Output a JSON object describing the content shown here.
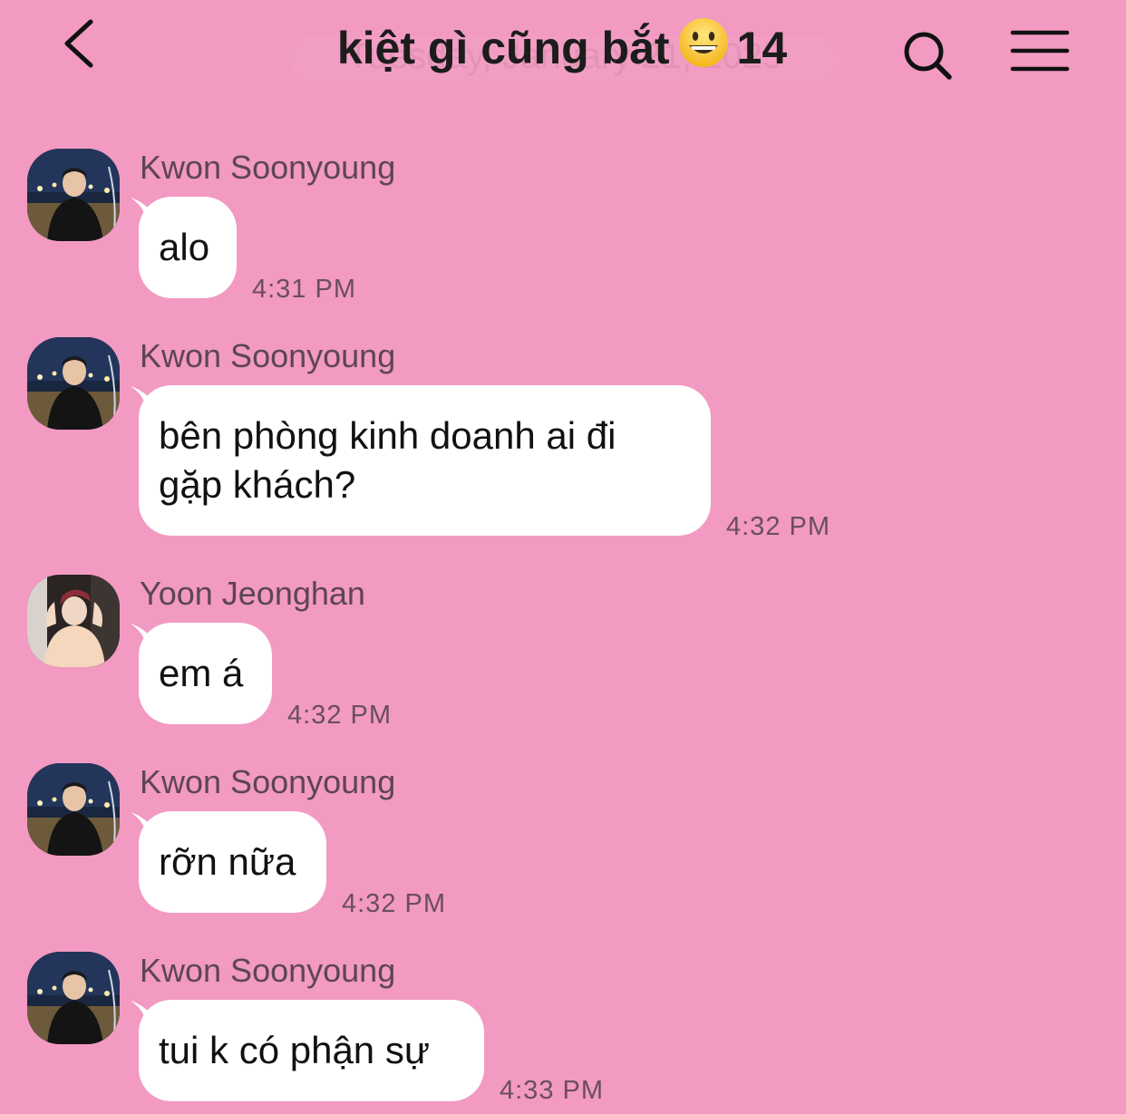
{
  "header": {
    "title": "kiệt gì cũng bắt",
    "member_count": "14",
    "date_ghost": "Tuesday, January 21, 2025",
    "icons": {
      "back": "chevron-left-icon",
      "search": "search-icon",
      "menu": "hamburger-menu-icon",
      "title_emoji": "grinning-face-emoji"
    }
  },
  "messages": [
    {
      "sender": "Kwon Soonyoung",
      "text": "alo",
      "time": "4:31 PM"
    },
    {
      "sender": "Kwon Soonyoung",
      "text_line1": "bên phòng kinh doanh ai đi",
      "text_line2": "gặp khách?",
      "time": "4:32 PM"
    },
    {
      "sender": "Yoon Jeonghan",
      "text": "em á",
      "time": "4:32 PM"
    },
    {
      "sender": "Kwon Soonyoung",
      "text": "rỡn nữa",
      "time": "4:32 PM"
    },
    {
      "sender": "Kwon Soonyoung",
      "text": "tui k có phận sự",
      "time": "4:33 PM"
    }
  ],
  "colors": {
    "background": "#f29ac2",
    "bubble": "#ffffff",
    "sender_text": "#5d4555",
    "time_text": "#6a4e5f"
  }
}
